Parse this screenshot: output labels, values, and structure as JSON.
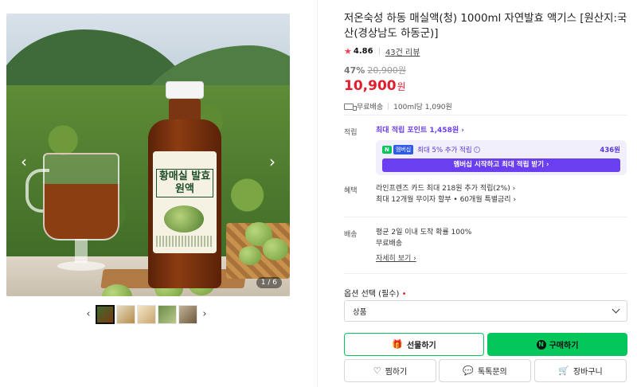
{
  "gallery": {
    "counter": "1 / 6",
    "prev_icon": "chevron-left-icon",
    "next_icon": "chevron-right-icon",
    "label_text": "황매실 발효원액"
  },
  "product": {
    "title": "저온숙성 하동 매실액(청) 1000ml 자연발효 액기스 [원산지:국산(경상남도 하동군)]",
    "rating": "4.86",
    "reviews": "43건 리뷰",
    "discount": "47%",
    "original_price": "20,900원",
    "sale_price": "10,900",
    "won": "원",
    "shipping": "무료배송",
    "unit_price": "100ml당 1,090원"
  },
  "points": {
    "label": "적립",
    "max_points": "최대 적립 포인트 1,458원 ›",
    "n_badge": "N",
    "m_badge": "멤버십",
    "extra": "최대 5% 추가 적립",
    "amount": "436원",
    "button": "멤버십 시작하고 최대 적립 받기 ›"
  },
  "benefits": {
    "label": "혜택",
    "line1": "라인프렌즈 카드 최대 218원 추가 적립(2%) ›",
    "line2": "최대 12개월 무이자 할부 • 60개월 특별금리 ›"
  },
  "delivery": {
    "label": "배송",
    "line1": "평균 2일 이내 도착 확률 100%",
    "line2": "무료배송",
    "detail": "자세히 보기 ›"
  },
  "option": {
    "label": "옵션 선택 (필수)",
    "required_mark": "•",
    "selected": "상품"
  },
  "buttons": {
    "gift": "선물하기",
    "buy": "구매하기",
    "wish": "찜하기",
    "talk": "톡톡문의",
    "cart": "장바구니"
  },
  "colors": {
    "accent_green": "#03c75a",
    "sale_red": "#e11d2e",
    "membership_purple": "#6a3ff0"
  }
}
